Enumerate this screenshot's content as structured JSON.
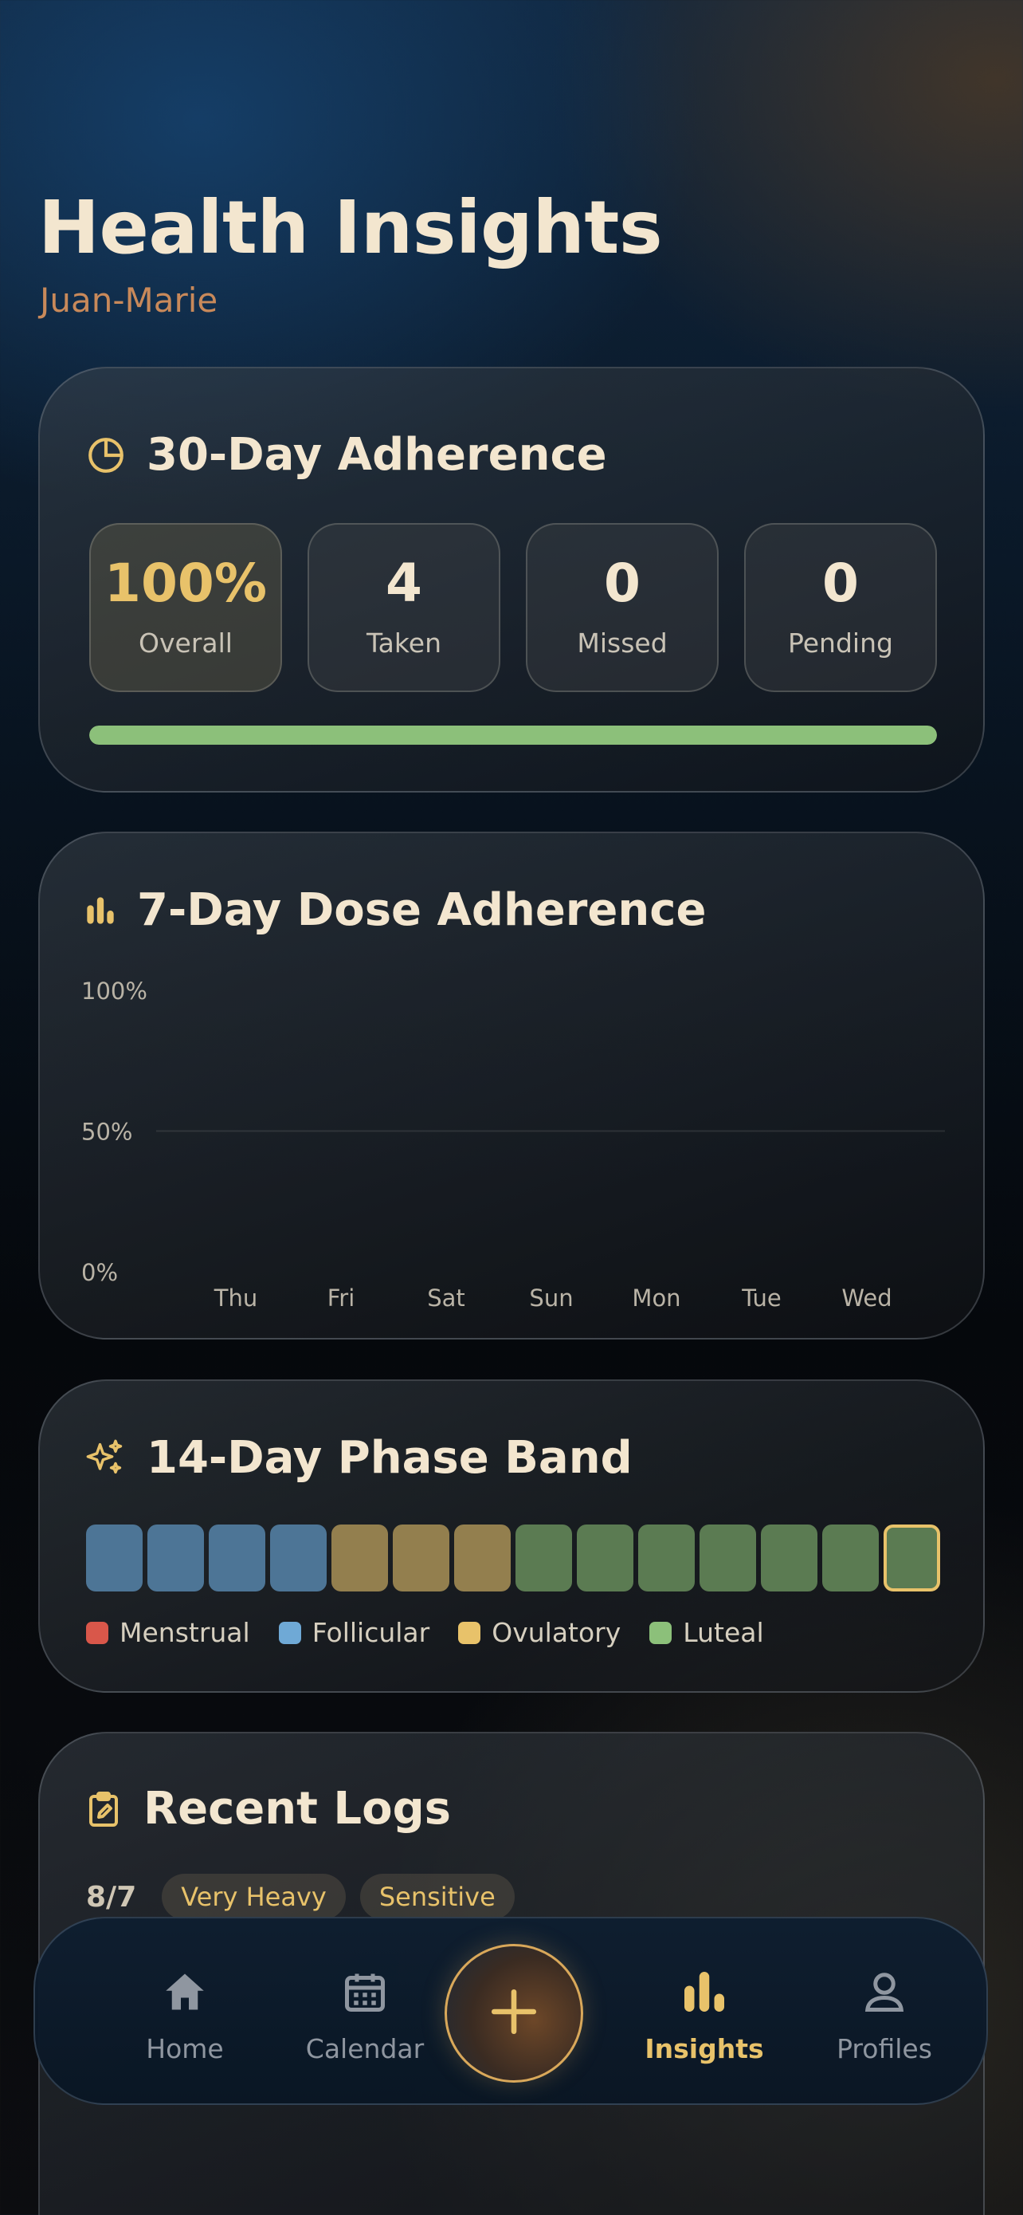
{
  "header": {
    "title": "Health Insights",
    "subtitle": "Juan-Marie"
  },
  "adherence30": {
    "title": "30-Day Adherence",
    "stats": [
      {
        "value": "100%",
        "label": "Overall"
      },
      {
        "value": "4",
        "label": "Taken"
      },
      {
        "value": "0",
        "label": "Missed"
      },
      {
        "value": "0",
        "label": "Pending"
      }
    ],
    "progress_fraction": 1.0,
    "progress_color": "#8cc07a"
  },
  "dose7": {
    "title": "7-Day Dose Adherence",
    "chart_data": {
      "type": "bar",
      "categories": [
        "Thu",
        "Fri",
        "Sat",
        "Sun",
        "Mon",
        "Tue",
        "Wed"
      ],
      "values": [
        0,
        0,
        0,
        0,
        0,
        0,
        0
      ],
      "ylim": [
        0,
        100
      ],
      "yticks": [
        "100%",
        "50%",
        "0%"
      ],
      "grid": true
    }
  },
  "phase14": {
    "title": "14-Day Phase Band",
    "days": [
      "follicular",
      "follicular",
      "follicular",
      "follicular",
      "ovulatory",
      "ovulatory",
      "ovulatory",
      "luteal",
      "luteal",
      "luteal",
      "luteal",
      "luteal",
      "luteal",
      "luteal"
    ],
    "current_index": 13,
    "legend": [
      {
        "label": "Menstrual",
        "color": "#d9574a"
      },
      {
        "label": "Follicular",
        "color": "#6fa9d6"
      },
      {
        "label": "Ovulatory",
        "color": "#e8c26a"
      },
      {
        "label": "Luteal",
        "color": "#8cc07a"
      }
    ]
  },
  "recent_logs": {
    "title": "Recent Logs",
    "rows": [
      {
        "date": "8/7",
        "tags": [
          "Very Heavy",
          "Sensitive"
        ]
      }
    ]
  },
  "nav": {
    "items": [
      {
        "label": "Home",
        "icon": "home-icon"
      },
      {
        "label": "Calendar",
        "icon": "calendar-icon"
      },
      {
        "label": "Insights",
        "icon": "bar-chart-icon",
        "active": true
      },
      {
        "label": "Profiles",
        "icon": "person-icon"
      }
    ],
    "add_icon": "plus-icon"
  },
  "colors": {
    "accent": "#e8c26a",
    "text": "#f3e6cf",
    "muted": "#c9c3b6"
  }
}
